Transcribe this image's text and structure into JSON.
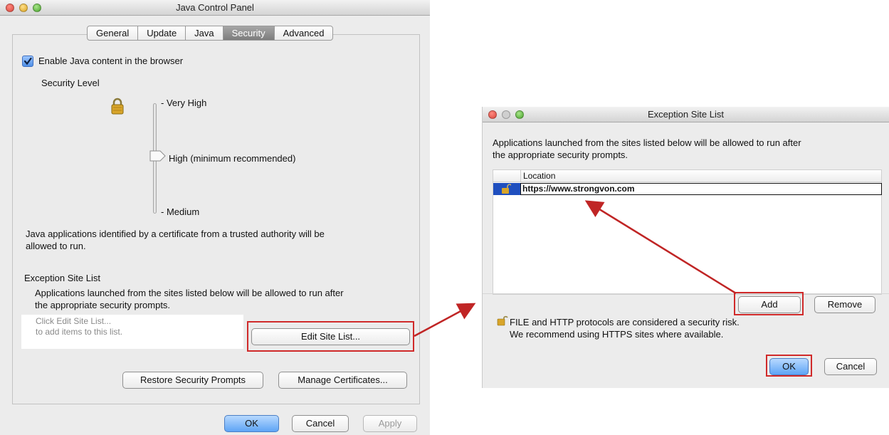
{
  "java_panel": {
    "title": "Java Control Panel",
    "tabs": [
      "General",
      "Update",
      "Java",
      "Security",
      "Advanced"
    ],
    "active_tab": "Security",
    "enable_checkbox_label": "Enable Java content in the browser",
    "enable_checked": true,
    "security_level_label": "Security Level",
    "levels": [
      "Very High",
      "High (minimum recommended)",
      "Medium"
    ],
    "selected_level": "High (minimum recommended)",
    "level_description_line1": "Java applications identified by a certificate from a trusted authority will be",
    "level_description_line2": "allowed to run.",
    "exception_header": "Exception Site List",
    "exception_desc_line1": "Applications launched from the sites listed below will be allowed to run after",
    "exception_desc_line2": "the appropriate security prompts.",
    "site_list_placeholder_line1": "Click Edit Site List...",
    "site_list_placeholder_line2": "to add items to this list.",
    "edit_site_list_button": "Edit Site List...",
    "restore_prompts_button": "Restore Security Prompts",
    "manage_certificates_button": "Manage Certificates...",
    "ok_button": "OK",
    "cancel_button": "Cancel",
    "apply_button": "Apply"
  },
  "exception_dialog": {
    "title": "Exception Site List",
    "description_line1": "Applications launched from the sites listed below will be allowed to run after",
    "description_line2": "the appropriate security prompts.",
    "column_header": "Location",
    "rows": [
      {
        "location": "https://www.strongvon.com"
      }
    ],
    "add_button": "Add",
    "remove_button": "Remove",
    "warning_line1": "FILE and HTTP protocols are considered a security risk.",
    "warning_line2": "We recommend using HTTPS sites where available.",
    "ok_button": "OK",
    "cancel_button": "Cancel"
  },
  "colors": {
    "highlight": "#d02a2a",
    "selected_row": "#1f4fbf",
    "default_button": "#5ea4f5"
  }
}
